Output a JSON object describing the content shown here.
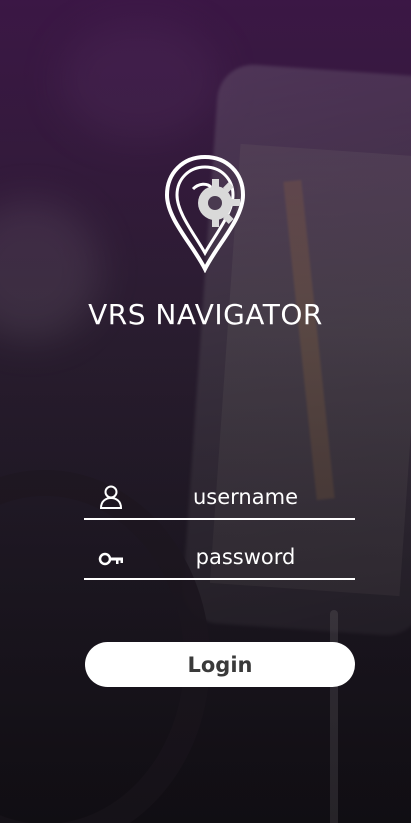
{
  "app": {
    "title": "VRS NAVIGATOR",
    "logo_icon": "map-pin-gear-logo"
  },
  "form": {
    "username": {
      "placeholder": "username",
      "value": "",
      "icon": "user-icon"
    },
    "password": {
      "placeholder": "password",
      "value": "",
      "icon": "key-icon"
    },
    "login_label": "Login"
  },
  "colors": {
    "accent_top": "#3a1a44",
    "text": "#ffffff",
    "button_bg": "#ffffff",
    "button_text": "#3a3a3a"
  }
}
